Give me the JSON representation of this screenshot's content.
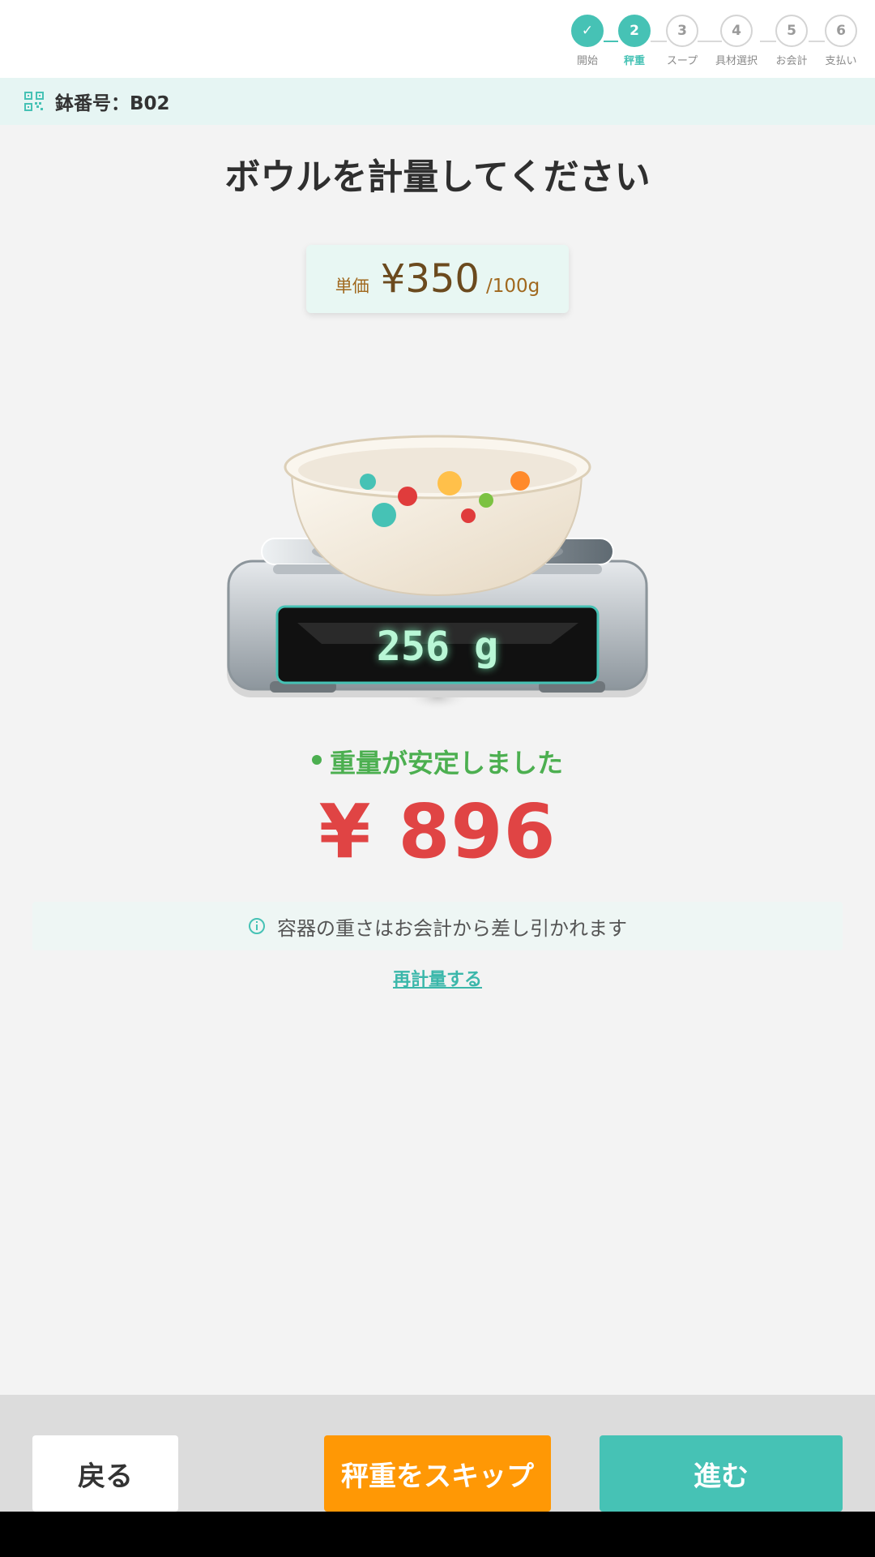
{
  "stepper": {
    "steps": [
      {
        "num": "✓",
        "label": "開始",
        "state": "done"
      },
      {
        "num": "2",
        "label": "秤重",
        "state": "active"
      },
      {
        "num": "3",
        "label": "スープ",
        "state": "todo"
      },
      {
        "num": "4",
        "label": "具材選択",
        "state": "todo"
      },
      {
        "num": "5",
        "label": "お会計",
        "state": "todo"
      },
      {
        "num": "6",
        "label": "支払い",
        "state": "todo"
      }
    ]
  },
  "bowl_bar": {
    "text": "鉢番号：B02",
    "icon": "qr-code-icon"
  },
  "title": "ボウルを計量してください",
  "price_card": {
    "label": "単価",
    "value": "¥350",
    "unit": "/100g"
  },
  "scale": {
    "reading": "256 g"
  },
  "status": {
    "text": "重量が安定しました"
  },
  "total": "¥ 896",
  "info": {
    "text": "容器の重さはお会計から差し引かれます",
    "icon": "info-icon"
  },
  "reweigh_label": "再計量する",
  "buttons": {
    "back": "戻る",
    "skip": "秤重をスキップ",
    "next": "進む"
  },
  "colors": {
    "accent": "#46c2b5",
    "skip": "#ff9805",
    "price": "#e04444",
    "stable": "#4caf50"
  }
}
